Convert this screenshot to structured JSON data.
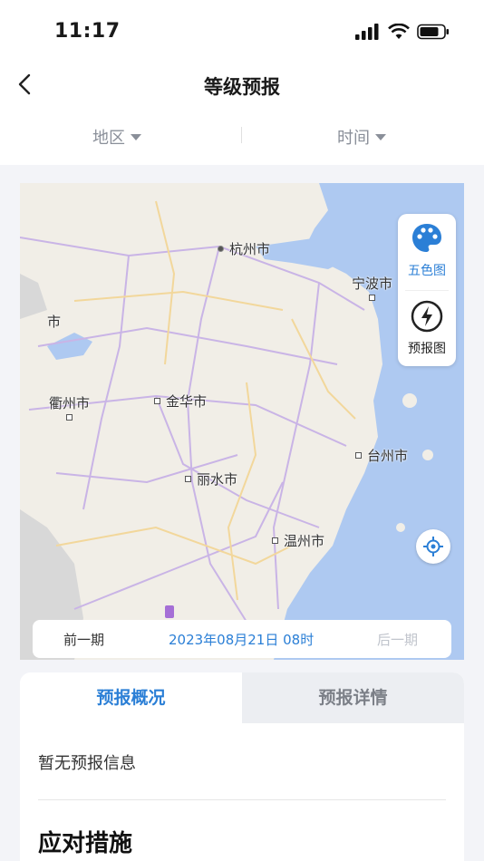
{
  "status": {
    "time": "11:17"
  },
  "nav": {
    "title": "等级预报"
  },
  "filters": {
    "region": "地区",
    "time": "时间"
  },
  "map": {
    "cities": {
      "hangzhou": "杭州市",
      "ningbo": "宁波市",
      "quzhou": "衢州市",
      "jinhua": "金华市",
      "taizhou": "台州市",
      "lishui": "丽水市",
      "wenzhou": "温州市",
      "partial_left": "市"
    },
    "panel": {
      "five_color": "五色图",
      "forecast": "预报图"
    },
    "colors": {
      "sea": "#aec9f1",
      "land": "#f1eee7",
      "road_purple": "#c9b4e6",
      "road_yellow": "#f2d79b",
      "accent": "#2b7fd6"
    }
  },
  "period": {
    "prev": "前一期",
    "current": "2023年08月21日 08时",
    "next": "后一期"
  },
  "tabs": {
    "overview": "预报概况",
    "details": "预报详情"
  },
  "content": {
    "no_info": "暂无预报信息",
    "measures_title": "应对措施"
  }
}
